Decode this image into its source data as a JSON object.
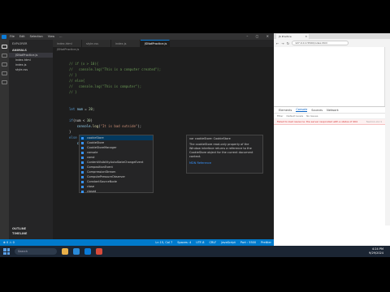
{
  "vscode": {
    "menus": [
      "File",
      "Edit",
      "Selection",
      "View",
      "..."
    ],
    "window_controls": "– ▢ ✕",
    "explorer": {
      "header": "EXPLORER",
      "folder": "ANIMALS",
      "files": [
        "JSNotPractice.js",
        "index.html",
        "index.js",
        "style.css"
      ],
      "bottom": [
        "OUTLINE",
        "TIMELINE"
      ]
    },
    "tabs": [
      "index.html",
      "style.css",
      "index.js",
      "JSNotPractice.js"
    ],
    "breadcrumb": "JSNotPractice.js",
    "lines": [
      {
        "n": "",
        "parts": [
          [
            "cmt",
            "// if (x > 10){"
          ]
        ]
      },
      {
        "n": "",
        "parts": [
          [
            "cmt",
            "//   console.log(\"This is a computer created\");"
          ]
        ]
      },
      {
        "n": "",
        "parts": [
          [
            "cmt",
            "// }"
          ]
        ]
      },
      {
        "n": "",
        "parts": [
          [
            "cmt",
            "// else{"
          ]
        ]
      },
      {
        "n": "",
        "parts": [
          [
            "cmt",
            "//   console.log(\"This is computer\");"
          ]
        ]
      },
      {
        "n": "",
        "parts": [
          [
            "cmt",
            "// }"
          ]
        ]
      },
      {
        "n": "",
        "parts": []
      },
      {
        "n": "",
        "parts": []
      },
      {
        "n": "",
        "parts": [
          [
            "kw",
            "let "
          ],
          [
            "var",
            "num"
          ],
          [
            "pl",
            " = "
          ],
          [
            "num",
            "20"
          ],
          [
            "pl",
            ";"
          ]
        ]
      },
      {
        "n": "",
        "parts": []
      },
      {
        "n": "",
        "parts": [
          [
            "kw",
            "if"
          ],
          [
            "pl",
            "(num < "
          ],
          [
            "num",
            "30"
          ],
          [
            "pl",
            ")"
          ]
        ]
      },
      {
        "n": "",
        "parts": [
          [
            "pl",
            "    "
          ],
          [
            "var",
            "console"
          ],
          [
            "pl",
            "."
          ],
          [
            "fn",
            "log"
          ],
          [
            "pl",
            "("
          ],
          [
            "str",
            "\"It is bad outside\""
          ],
          [
            "pl",
            ");"
          ]
        ]
      },
      {
        "n": "",
        "parts": [
          [
            "pl",
            "}"
          ]
        ]
      },
      {
        "n": "",
        "parts": [
          [
            "kw",
            "else if"
          ],
          [
            "pl",
            " (num > "
          ],
          [
            "num",
            "30"
          ],
          [
            "pl",
            "){"
          ]
        ]
      },
      {
        "n": "",
        "parts": [
          [
            "pl",
            "    "
          ],
          [
            "var",
            "co"
          ]
        ]
      }
    ],
    "suggestions": [
      {
        "label": "cookieStore",
        "m": "co"
      },
      {
        "label": "CookieStore",
        "m": "Co"
      },
      {
        "label": "CookieStoreManager",
        "m": "Co"
      },
      {
        "label": "console",
        "m": "co"
      },
      {
        "label": "const",
        "m": "co"
      },
      {
        "label": "ContentVisibilityAutoStateChangeEvent",
        "m": "Co"
      },
      {
        "label": "CompositionEvent",
        "m": "Co"
      },
      {
        "label": "CompressionStream",
        "m": "Co"
      },
      {
        "label": "ComputePressureObserver",
        "m": "Co"
      },
      {
        "label": "ConstantSourceNode",
        "m": "Co"
      },
      {
        "label": "close",
        "m": "c"
      },
      {
        "label": "closed",
        "m": "c"
      }
    ],
    "detail": {
      "title": "var cookieStore: CookieStore",
      "desc": "The cookieStore read-only property of the Window interface returns a reference to the CookieStore object for the current document context.",
      "link": "MDN Reference"
    },
    "status": {
      "left": "⊗ 0 ⚠ 0",
      "right": [
        "Ln 15, Col 7",
        "Spaces: 4",
        "UTF-8",
        "CRLF",
        "JavaScript",
        "Port : 5500",
        "Prettier"
      ]
    }
  },
  "browser": {
    "tab_title": "JS Practice",
    "url": "127.0.0.1:5500/index.html",
    "devtools_tabs": [
      "Elements",
      "Console",
      "Sources",
      "Network"
    ],
    "console_filter": [
      "Filter",
      "Default levels",
      "No Issues"
    ],
    "error_message": "Failed to load resource: the server responded with a status of 404",
    "error_source": "favicon.ico:1"
  },
  "taskbar": {
    "search": "Search",
    "time": "4:24 PM",
    "date": "9/29/2024"
  },
  "colors": {
    "accent": "#007acc",
    "editor_bg": "#1e1e1e"
  }
}
